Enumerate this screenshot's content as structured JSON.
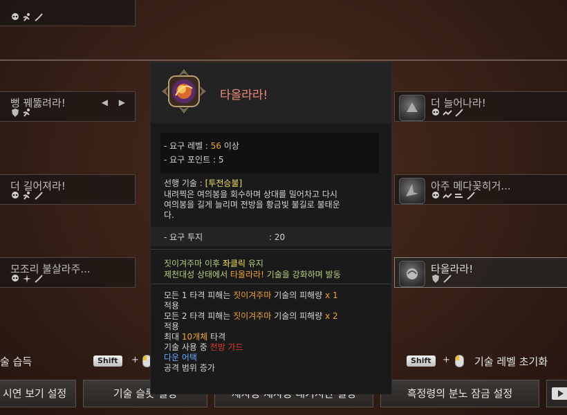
{
  "cards": {
    "top_left": {
      "title": ""
    },
    "left1": {
      "title": "뻥 꿰뚫려라!",
      "arrows": "◀ ▶"
    },
    "left2": {
      "title": "더 길어져라!"
    },
    "left3": {
      "title": "모조리 불살라주..."
    },
    "right1": {
      "title": "더 늘어나라!"
    },
    "right2": {
      "title": "아주 메다꽂히거..."
    },
    "right3": {
      "title": "타올라라!"
    }
  },
  "tooltip": {
    "title": "타올라라!",
    "req_level_label": "- 요구 레벨 : ",
    "req_level_value": "56",
    "req_level_suffix": " 이상",
    "req_points": "- 요구 포인트 : 5",
    "prereq_label": "선행 기술 : ",
    "prereq_value": "[투전승불]",
    "desc1": "내려찍은 여의봉을 회수하며 상대를 밀어차고 다시",
    "desc2": "여의봉을 길게 늘리며 전방을 황금빛 불길로 불태운",
    "desc3": "다.",
    "req_fight_label": "- 요구 투지",
    "req_fight_value": ": 20",
    "cond1_a": "짓이겨주마 이후 ",
    "cond1_b": "좌클릭",
    "cond1_c": " 유지",
    "cond2_a": "제천대성 상태에서 ",
    "cond2_b": "타올라라!",
    "cond2_c": " 기술을 강화하며 발동",
    "eff1_a": "모든 1 타격 피해는 ",
    "eff1_b": "짓이겨주마",
    "eff1_c": " 기술의 피해량 ",
    "eff1_d": "x 1",
    "eff1_e": "적용",
    "eff2_a": "모든 2 타격 피해는 ",
    "eff2_b": "짓이겨주마",
    "eff2_c": " 기술의 피해량 ",
    "eff2_d": "x 2",
    "eff2_e": "적용",
    "eff3_a": "최대 ",
    "eff3_b": "10개체",
    "eff3_c": " 타격",
    "eff4_a": "기술 사용 중 ",
    "eff4_b": "전방 가드",
    "eff5": "다운 어택",
    "eff6": "공격 범위 증가"
  },
  "bottom": {
    "learn_label": "술 습득",
    "shift_key": "Shift",
    "plus": "+",
    "reset_label": "기술 레벨 초기화",
    "ghost_learn": "습득",
    "ghost_reset": "기술 초기화"
  },
  "buttons": {
    "demo_settings": "시연 보기 설정",
    "skill_slot_settings": "기술 슬롯 설정",
    "middle": "제자동 재사용 대기시간 설정",
    "rage_lock": "흑정령의 분노 잠금 설정"
  },
  "colors": {
    "accent_orange": "#f0a430",
    "title_red": "#f08a7a",
    "condition_green": "#b6d07a",
    "highlight_yellow": "#f0e060",
    "guard_red": "#e23a2a",
    "down_attack_blue": "#66aaff"
  }
}
